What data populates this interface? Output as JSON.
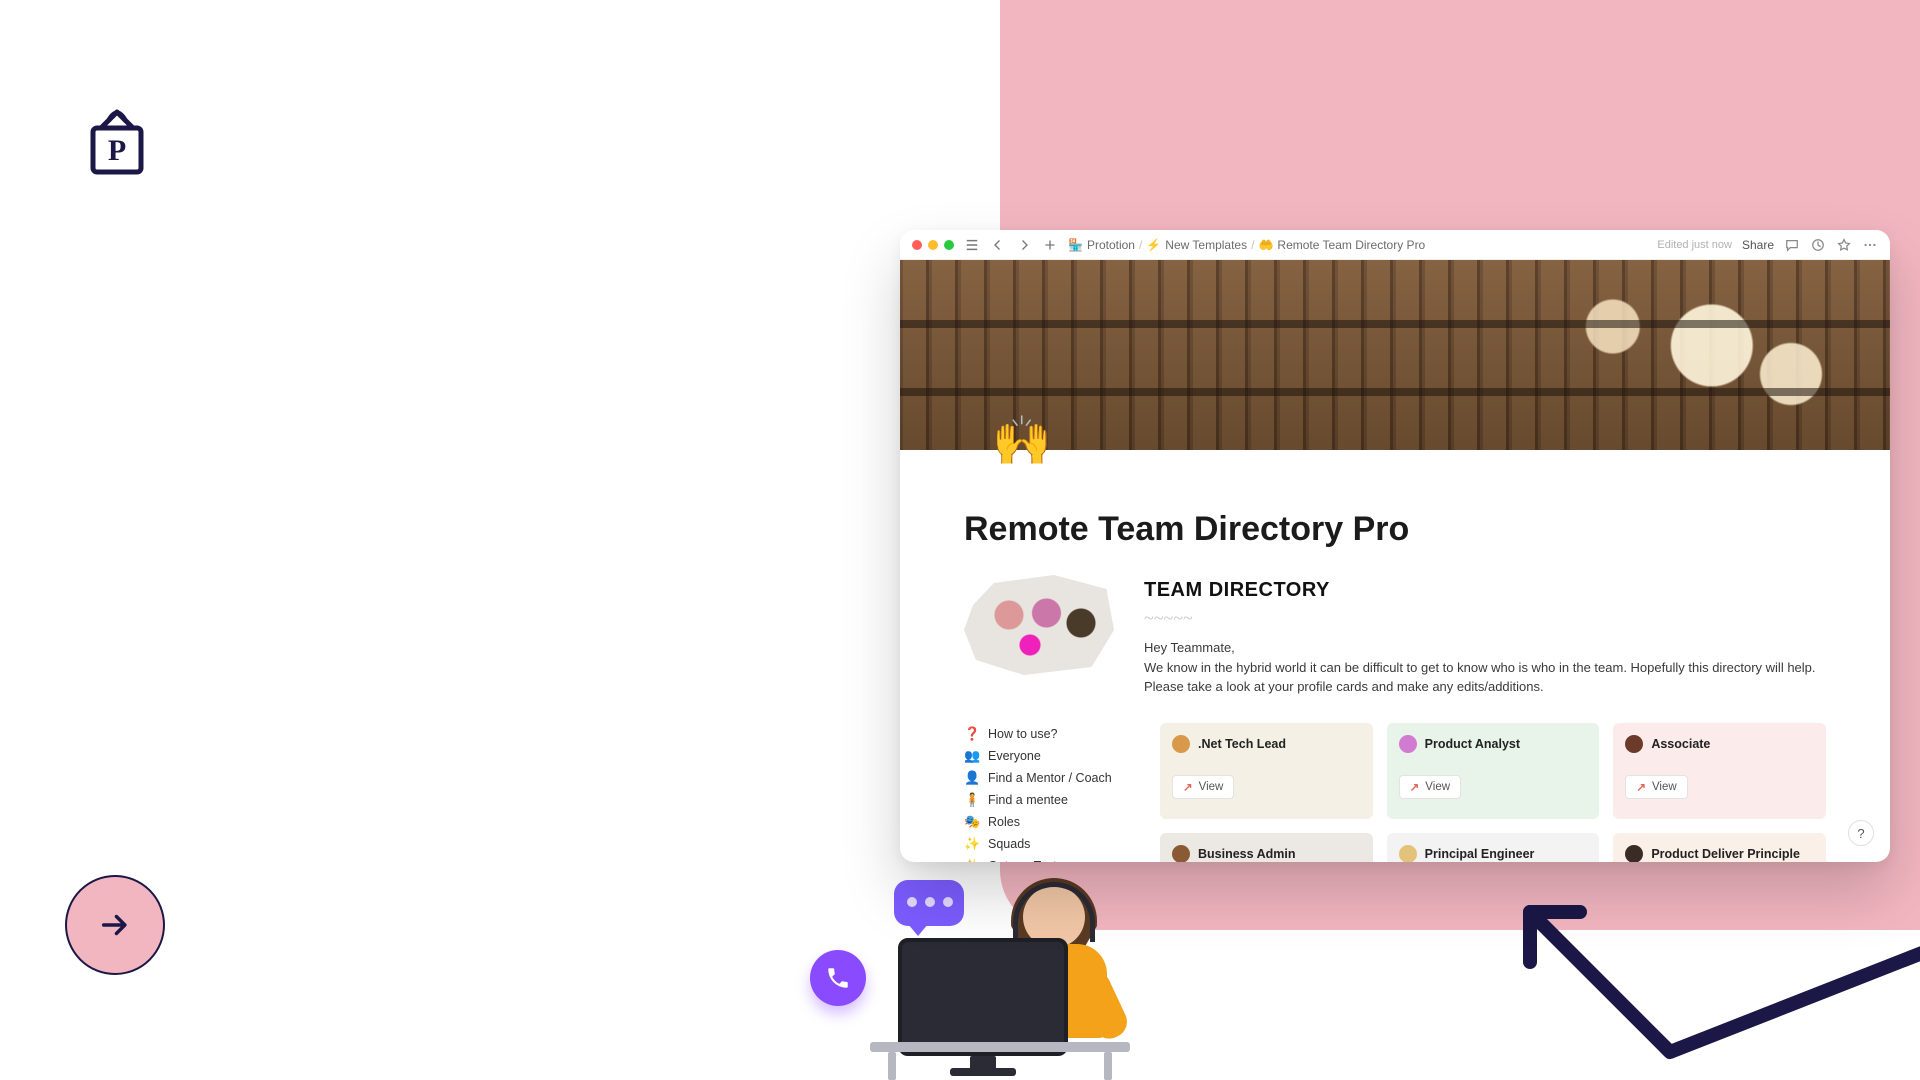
{
  "toolbar": {
    "edited_status": "Edited just now",
    "share_label": "Share"
  },
  "breadcrumbs": [
    {
      "icon": "🏪",
      "label": "Prototion"
    },
    {
      "icon": "⚡",
      "label": "New Templates"
    },
    {
      "icon": "🤲",
      "label": "Remote Team Directory Pro"
    }
  ],
  "page": {
    "icon": "🙌",
    "title": "Remote Team Directory Pro"
  },
  "intro": {
    "heading": "TEAM DIRECTORY",
    "greeting": "Hey Teammate,",
    "body": "We know in the hybrid world it can be difficult to get to know who is who in the team. Hopefully this directory will help. Please take a look at your profile cards and make any edits/additions."
  },
  "nav": [
    {
      "icon": "❓",
      "label": "How to use?"
    },
    {
      "icon": "👥",
      "label": "Everyone"
    },
    {
      "icon": "👤",
      "label": "Find a Mentor / Coach"
    },
    {
      "icon": "🧍",
      "label": "Find a mentee"
    },
    {
      "icon": "🎭",
      "label": "Roles"
    },
    {
      "icon": "✨",
      "label": "Squads"
    },
    {
      "icon": "✨",
      "label": "Get …y Test"
    }
  ],
  "view_label": "View",
  "cards": [
    {
      "role": ".Net Tech Lead",
      "bg": "#f4f0e6",
      "avatar": "#d89a4a",
      "expanded": true
    },
    {
      "role": "Product Analyst",
      "bg": "#e8f3ea",
      "avatar": "#d17bd1",
      "expanded": true
    },
    {
      "role": "Associate",
      "bg": "#fbeceb",
      "avatar": "#6b3a2a",
      "expanded": true
    },
    {
      "role": "Business Admin",
      "bg": "#ece9e4",
      "avatar": "#8a5a34",
      "expanded": false
    },
    {
      "role": "Principal Engineer",
      "bg": "#f3f3f3",
      "avatar": "#e3c27a",
      "expanded": false
    },
    {
      "role": "Product Deliver Principle",
      "bg": "#faf0e8",
      "avatar": "#3a2c24",
      "expanded": false
    }
  ],
  "help_fab": "?"
}
